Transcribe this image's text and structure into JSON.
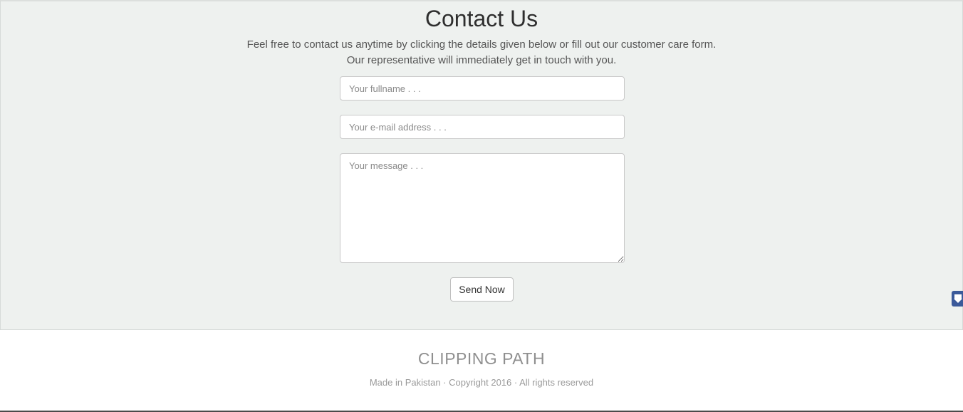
{
  "contact": {
    "title": "Contact Us",
    "description_line1": "Feel free to contact us anytime by clicking the details given below or fill out our customer care form.",
    "description_line2": "Our representative will immediately get in touch with you.",
    "fullname_placeholder": "Your fullname . . .",
    "email_placeholder": "Your e-mail address . . .",
    "message_placeholder": "Your message . . .",
    "send_label": "Send Now"
  },
  "side_tab": {
    "icon": "arrow-down-icon",
    "color": "#3b5a9a"
  },
  "footer": {
    "brand": "CLIPPING PATH",
    "copyright": "Made in Pakistan · Copyright 2016 · All rights reserved"
  }
}
